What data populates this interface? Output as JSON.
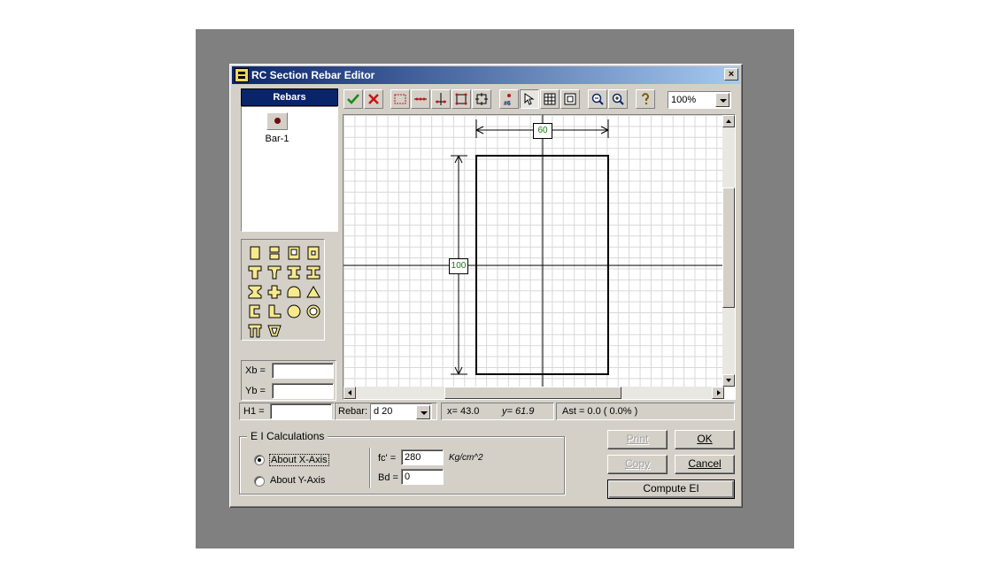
{
  "window": {
    "title": "RC Section Rebar Editor",
    "close_label": "×"
  },
  "rebars": {
    "header": "Rebars",
    "items": [
      {
        "label": "Bar-1"
      }
    ]
  },
  "shapes": [
    "rect-section-icon",
    "rect-two-bars-icon",
    "hollow-rect-icon",
    "hollow-rect-small-icon",
    "tee-section-icon",
    "tee-flanged-icon",
    "tee-variant-icon",
    "i-section-icon",
    "i-section-alt-icon",
    "cross-section-icon",
    "arch-section-icon",
    "triangle-section-icon",
    "channel-section-icon",
    "l-section-icon",
    "circle-section-icon",
    "ring-section-icon",
    "double-tee-icon",
    "trapezoid-section-icon"
  ],
  "fields": {
    "xb_label": "Xb =",
    "xb_value": "",
    "yb_label": "Yb =",
    "yb_value": "",
    "h1_label": "H1 =",
    "h1_value": ""
  },
  "toolbar": {
    "zoom": "100%",
    "rebar_size_tag": "#6"
  },
  "canvas": {
    "width_dim": "60",
    "height_dim": "100"
  },
  "status": {
    "rebar_label": "Rebar:",
    "rebar_value": "d 20",
    "x_readout": "x= 43.0",
    "y_readout": "y= 61.9",
    "ast_readout": "Ast = 0.0  ( 0.0% )"
  },
  "ei": {
    "title": "E I  Calculations",
    "about_x": "About X-Axis",
    "about_y": "About Y-Axis",
    "fc_label": "fc' =",
    "fc_value": "280",
    "fc_unit": "Kg/cm^2",
    "bd_label": "Bd =",
    "bd_value": "0"
  },
  "buttons": {
    "print": "Print",
    "ok": "OK",
    "copy": "Copy",
    "cancel": "Cancel",
    "compute": "Compute EI"
  },
  "colors": {
    "title_start": "#0a246a",
    "title_end": "#a6caf0",
    "dim_label_text": "#1a7a1a",
    "check_green": "#1a8a1a",
    "cross_red": "#cc1111"
  }
}
